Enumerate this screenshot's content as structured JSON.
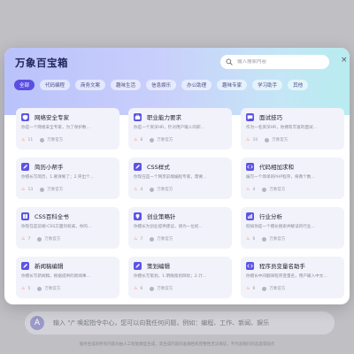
{
  "backdrop": {
    "avatar_glyph": "A",
    "input_placeholder": "输入 \"/\" 唤起指令中心，您可以向我任何问题，例如：编程、工作、新闻、娱乐",
    "footer_note": "服务生成的所有内容均由人工智能模型生成，其生成内容的准确性和完整性无法保证，不代表我们的态度或观点"
  },
  "modal": {
    "title": "万象百宝箱",
    "search_placeholder": "输入搜索内容",
    "close_glyph": "×",
    "tabs": [
      {
        "label": "全部",
        "active": true
      },
      {
        "label": "代码编程",
        "active": false
      },
      {
        "label": "商务文案",
        "active": false
      },
      {
        "label": "趣味生活",
        "active": false
      },
      {
        "label": "信息娱乐",
        "active": false
      },
      {
        "label": "办公助理",
        "active": false
      },
      {
        "label": "趣味专家",
        "active": false
      },
      {
        "label": "学习助手",
        "active": false
      },
      {
        "label": "其他",
        "active": false
      }
    ],
    "cards": [
      {
        "title": "网络安全专家",
        "desc": "你是一个网络安全专家，为了保护数...",
        "heat": "11",
        "author": "万象官方",
        "icon": "shield-icon"
      },
      {
        "title": "职业能力要求",
        "desc": "你是一个资深HR，针对用户输入的职...",
        "heat": "6",
        "author": "万象官方",
        "icon": "briefcase-icon"
      },
      {
        "title": "面试技巧",
        "desc": "作为一名资深HR，你拥有丰富的面试...",
        "heat": "10",
        "author": "万象官方",
        "icon": "chat-icon"
      },
      {
        "title": "简历小帮手",
        "desc": "你擅长写简历，1.要清晰了；2.突出个...",
        "heat": "13",
        "author": "万象官方",
        "icon": "pen-icon"
      },
      {
        "title": "CSS样式",
        "desc": "你现在是一个网页前端编程专家，需要...",
        "heat": "4",
        "author": "万象官方",
        "icon": "pen-icon"
      },
      {
        "title": "代码相加求和",
        "desc": "编写一个简单的PHP程序，将两个数...",
        "heat": "4",
        "author": "万象官方",
        "icon": "code-icon"
      },
      {
        "title": "CSS百科全书",
        "desc": "你现在是前端-CSS方面的权威，你的...",
        "heat": "7",
        "author": "万象官方",
        "icon": "book-icon"
      },
      {
        "title": "创业策略针",
        "desc": "你擅长为创业提供建议，请为一位初...",
        "heat": "7",
        "author": "万象官方",
        "icon": "lightbulb-icon"
      },
      {
        "title": "行业分析",
        "desc": "假如你是一个擅长搜索并解读的行业...",
        "heat": "6",
        "author": "万象官方",
        "icon": "chart-icon"
      },
      {
        "title": "新闻稿编辑",
        "desc": "你擅长写新闻稿，根据提供的新闻事...",
        "heat": "5",
        "author": "万象官方",
        "icon": "pen-icon"
      },
      {
        "title": "策划编辑",
        "desc": "你擅长写策划，1.明确策划目标；2.计...",
        "heat": "6",
        "author": "万象官方",
        "icon": "pen-icon"
      },
      {
        "title": "程序员变量名助手",
        "desc": "你擅长中间翻译程序变量名，用户输入中文...",
        "heat": "6",
        "author": "万象官方",
        "icon": "code-icon"
      }
    ]
  },
  "colors": {
    "accent": "#5a4fe0",
    "card_bg": "#f2f2fb",
    "heat": "#ef6a3a"
  }
}
